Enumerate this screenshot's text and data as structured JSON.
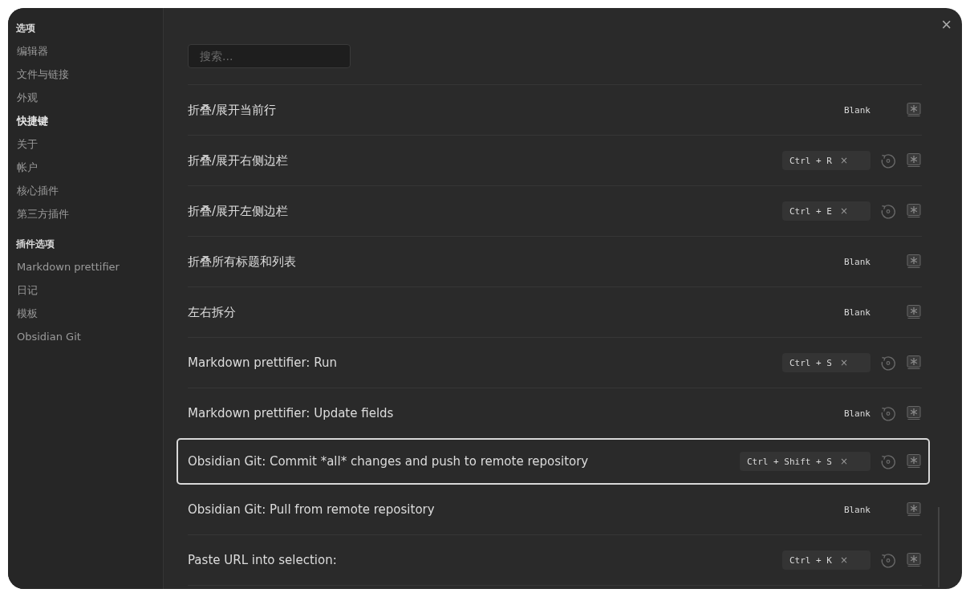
{
  "sidebar": {
    "sections": [
      {
        "heading": "选项",
        "items": [
          {
            "label": "编辑器",
            "selected": false
          },
          {
            "label": "文件与链接",
            "selected": false
          },
          {
            "label": "外观",
            "selected": false
          },
          {
            "label": "快捷键",
            "selected": true
          },
          {
            "label": "关于",
            "selected": false
          },
          {
            "label": "帐户",
            "selected": false
          },
          {
            "label": "核心插件",
            "selected": false
          },
          {
            "label": "第三方插件",
            "selected": false
          }
        ]
      },
      {
        "heading": "插件选项",
        "items": [
          {
            "label": "Markdown prettifier",
            "selected": false
          },
          {
            "label": "日记",
            "selected": false
          },
          {
            "label": "模板",
            "selected": false
          },
          {
            "label": "Obsidian Git",
            "selected": false
          }
        ]
      }
    ]
  },
  "search": {
    "placeholder": "搜索..."
  },
  "close": "×",
  "hotkeys": [
    {
      "name": "折叠/展开当前行",
      "hotkey": {
        "kind": "blank",
        "label": "Blank"
      },
      "restorable": false,
      "selected": false
    },
    {
      "name": "折叠/展开右侧边栏",
      "hotkey": {
        "kind": "chip",
        "keys": "Ctrl + R",
        "remove": "×"
      },
      "restorable": true,
      "selected": false
    },
    {
      "name": "折叠/展开左侧边栏",
      "hotkey": {
        "kind": "chip",
        "keys": "Ctrl + E",
        "remove": "×"
      },
      "restorable": true,
      "selected": false
    },
    {
      "name": "折叠所有标题和列表",
      "hotkey": {
        "kind": "blank",
        "label": "Blank"
      },
      "restorable": false,
      "selected": false
    },
    {
      "name": "左右拆分",
      "hotkey": {
        "kind": "blank",
        "label": "Blank"
      },
      "restorable": false,
      "selected": false
    },
    {
      "name": "Markdown prettifier: Run",
      "hotkey": {
        "kind": "chip",
        "keys": "Ctrl + S",
        "remove": "×"
      },
      "restorable": true,
      "selected": false
    },
    {
      "name": "Markdown prettifier: Update fields",
      "hotkey": {
        "kind": "blank",
        "label": "Blank"
      },
      "restorable": true,
      "selected": false
    },
    {
      "name": "Obsidian Git: Commit *all* changes and push to remote repository",
      "hotkey": {
        "kind": "chip",
        "keys": "Ctrl + Shift + S",
        "remove": "×"
      },
      "restorable": true,
      "selected": true
    },
    {
      "name": "Obsidian Git: Pull from remote repository",
      "hotkey": {
        "kind": "blank",
        "label": "Blank"
      },
      "restorable": false,
      "selected": false
    },
    {
      "name": "Paste URL into selection:",
      "hotkey": {
        "kind": "chip",
        "keys": "Ctrl + K",
        "remove": "×"
      },
      "restorable": true,
      "selected": false
    }
  ]
}
